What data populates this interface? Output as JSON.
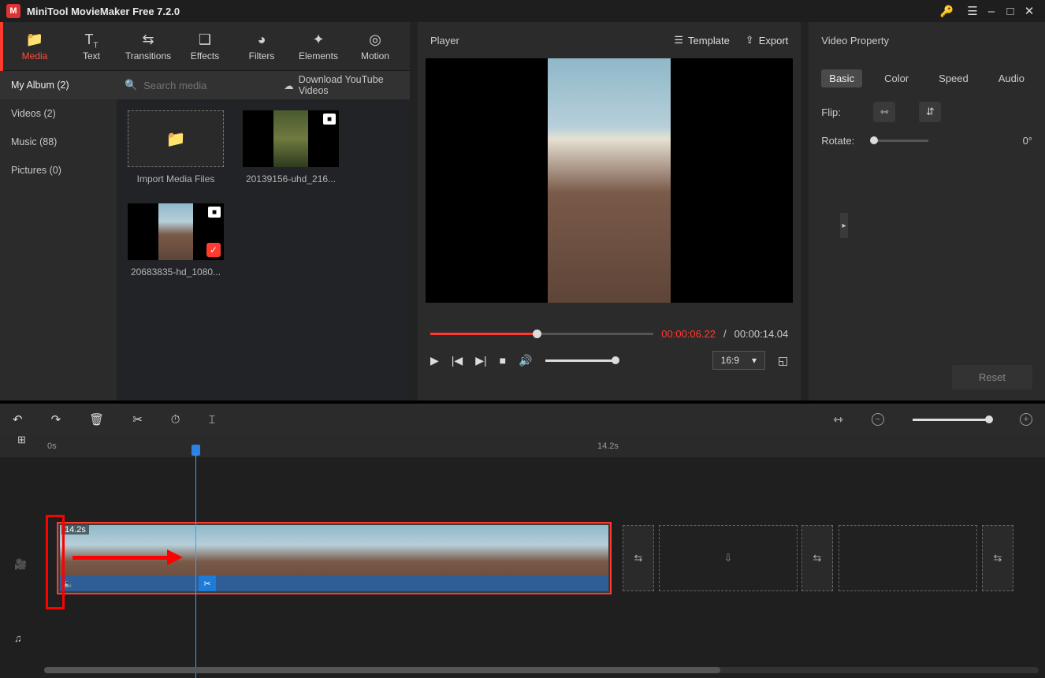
{
  "title": "MiniTool MovieMaker Free 7.2.0",
  "tabs": {
    "media": "Media",
    "text": "Text",
    "transitions": "Transitions",
    "effects": "Effects",
    "filters": "Filters",
    "elements": "Elements",
    "motion": "Motion"
  },
  "albums": {
    "myalbum": "My Album (2)",
    "videos": "Videos (2)",
    "music": "Music (88)",
    "pictures": "Pictures (0)"
  },
  "search_placeholder": "Search media",
  "download_link": "Download YouTube Videos",
  "tiles": {
    "import": "Import Media Files",
    "t1": "20139156-uhd_216...",
    "t2": "20683835-hd_1080..."
  },
  "player": {
    "title": "Player",
    "template": "Template",
    "export": "Export",
    "current": "00:00:06.22",
    "sep": "/",
    "total": "00:00:14.04",
    "aspect": "16:9"
  },
  "property": {
    "title": "Video Property",
    "basic": "Basic",
    "color": "Color",
    "speed": "Speed",
    "audio": "Audio",
    "flip": "Flip:",
    "rotate": "Rotate:",
    "rotate_val": "0°",
    "reset": "Reset"
  },
  "timeline": {
    "zero": "0s",
    "end": "14.2s",
    "clipdur": "14.2s"
  }
}
